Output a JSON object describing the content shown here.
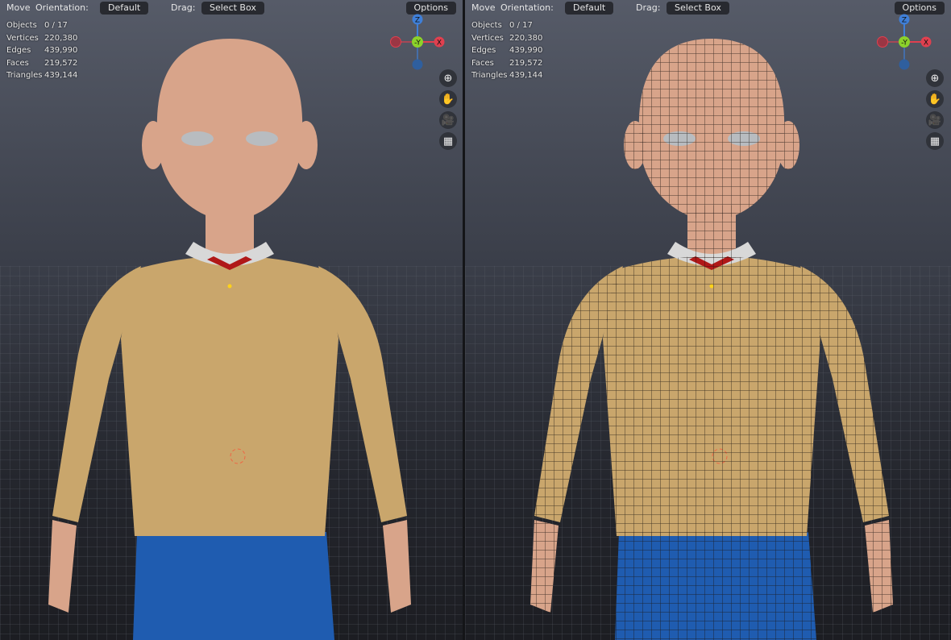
{
  "header": {
    "move_label": "Move",
    "orientation_label": "Orientation:",
    "orientation_value": "Default",
    "drag_label": "Drag:",
    "drag_value": "Select Box",
    "options_label": "Options"
  },
  "viewports": [
    {
      "name": "solid",
      "stats": [
        {
          "k": "Objects",
          "v": "0 / 17"
        },
        {
          "k": "Vertices",
          "v": "220,380"
        },
        {
          "k": "Edges",
          "v": "439,990"
        },
        {
          "k": "Faces",
          "v": "219,572"
        },
        {
          "k": "Triangles",
          "v": "439,144"
        }
      ]
    },
    {
      "name": "wireframe",
      "stats": [
        {
          "k": "Objects",
          "v": "0 / 17"
        },
        {
          "k": "Vertices",
          "v": "220,380"
        },
        {
          "k": "Edges",
          "v": "439,990"
        },
        {
          "k": "Faces",
          "v": "219,572"
        },
        {
          "k": "Triangles",
          "v": "439,144"
        }
      ]
    }
  ],
  "gizmo": {
    "z": "Z",
    "y": "-Y",
    "x": "X"
  },
  "tools": [
    {
      "icon": "zoom-icon",
      "glyph": "⊕"
    },
    {
      "icon": "hand-icon",
      "glyph": "✋"
    },
    {
      "icon": "camera-icon",
      "glyph": "🎥"
    },
    {
      "icon": "grid-icon",
      "glyph": "▦"
    }
  ],
  "colors": {
    "skin": "#d8a48a",
    "sweater": "#c9a66c",
    "skirt": "#1f5cb0",
    "collar": "#d8d8d8",
    "tie": "#b01818",
    "x_axis": "#e0404f",
    "y_axis": "#8cd22a",
    "z_axis": "#3f7fd8"
  }
}
